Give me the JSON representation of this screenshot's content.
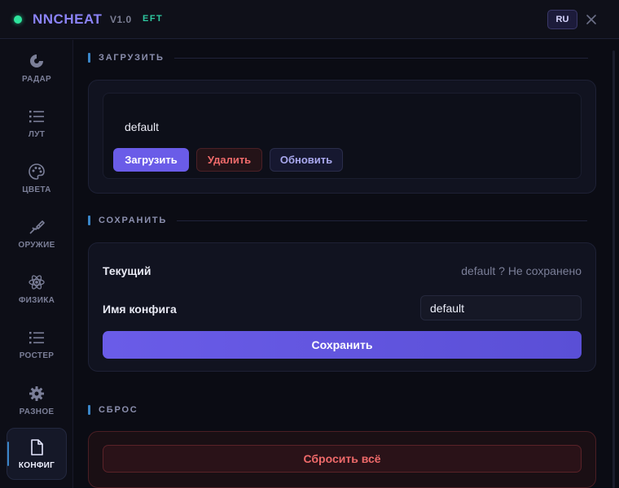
{
  "window": {
    "app_name": "NNCHEAT",
    "version": "V1.0",
    "tag": "EFT",
    "lang": "RU",
    "colors": {
      "accent": "#6a5ce8",
      "status": "#2ee59d",
      "danger": "#ef6a6a"
    }
  },
  "sidebar": {
    "items": [
      {
        "label": "РАДАР",
        "icon": "radar-icon"
      },
      {
        "label": "ЛУТ",
        "icon": "list-icon"
      },
      {
        "label": "ЦВЕТА",
        "icon": "palette-icon"
      },
      {
        "label": "ОРУЖИЕ",
        "icon": "rifle-icon"
      },
      {
        "label": "ФИЗИКА",
        "icon": "atom-icon"
      },
      {
        "label": "РОСТЕР",
        "icon": "list-icon"
      },
      {
        "label": "РАЗНОЕ",
        "icon": "gear-icon"
      },
      {
        "label": "КОНФИГ",
        "icon": "file-icon",
        "active": true
      }
    ]
  },
  "load": {
    "section_title": "ЗАГРУЗИТЬ",
    "selected_config": "default",
    "load_label": "Загрузить",
    "delete_label": "Удалить",
    "refresh_label": "Обновить"
  },
  "save": {
    "section_title": "СОХРАНИТЬ",
    "current_label": "Текущий",
    "current_value": "default ? Не сохранено",
    "name_label": "Имя конфига",
    "name_value": "default",
    "save_label": "Сохранить"
  },
  "reset": {
    "section_title": "СБРОС",
    "reset_label": "Сбросить всё"
  }
}
